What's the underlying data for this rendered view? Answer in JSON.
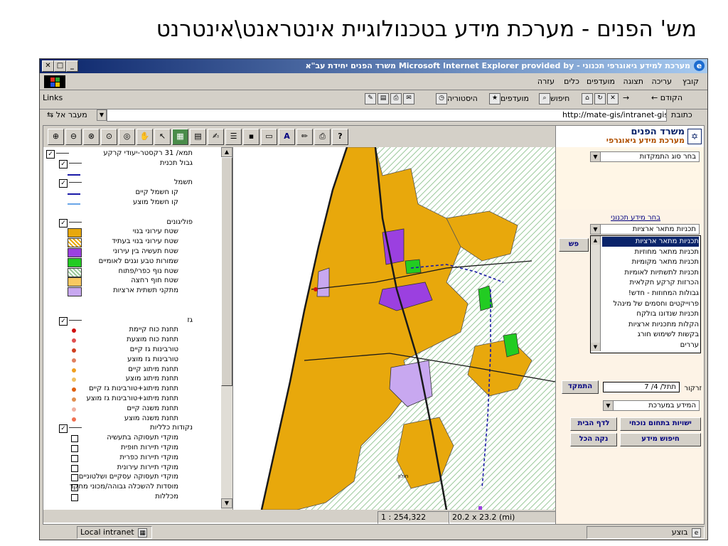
{
  "slide": {
    "title": "מש' הפנים - מערכת מידע בטכנולוגיית אינטראנט\\אינטרנט"
  },
  "window": {
    "title": "מערכת למידע גיאוגרפי תכנוני - Microsoft Internet Explorer provided by משרד הפנים יחידת עב\"א",
    "menu": [
      "קובץ",
      "עריכה",
      "תצוגה",
      "מועדפים",
      "כלים",
      "עזרה"
    ],
    "toolbar": {
      "back": "הקודם",
      "search": "חיפוש",
      "favorites": "מועדפים",
      "history": "היסטוריה",
      "links": "Links"
    },
    "address": {
      "label": "כתובת",
      "url": "http://mate-gis/intranet-gis/",
      "go": "מעבר אל"
    },
    "status": {
      "ready": "בוצע",
      "zone": "Local intranet"
    }
  },
  "legend": {
    "items": [
      {
        "label": "תמא/ 31 רקסטר-יעודי קרקע",
        "kind": "group"
      },
      {
        "label": "גבול תכנית",
        "kind": "group"
      },
      {
        "label": "",
        "kind": "line",
        "color": "#1a1aa8"
      },
      {
        "label": "תשמל",
        "kind": "group"
      },
      {
        "label": "קו חשמל קיים",
        "kind": "line",
        "color": "#1a1aa8"
      },
      {
        "label": "קו חשמל מוצע",
        "kind": "line",
        "color": "#6aa6e8"
      },
      {
        "label": "",
        "kind": "blank"
      },
      {
        "label": "פוליגונים",
        "kind": "group"
      },
      {
        "label": "שטח עירוני בנוי",
        "kind": "fill",
        "color": "#e8a80c"
      },
      {
        "label": "שטח עירוני בנוי בעתיד",
        "kind": "hatch",
        "color": "#e8a80c"
      },
      {
        "label": "שטח תעשיה בין עירוני",
        "kind": "fill",
        "color": "#9b40e0"
      },
      {
        "label": "שמורות טבע וגנים לאומיים",
        "kind": "fill",
        "color": "#22cc22"
      },
      {
        "label": "שטח נוף כפרי/פתוח",
        "kind": "hatch",
        "color": "#9ac89a"
      },
      {
        "label": "שטח חוף רחצה",
        "kind": "fill",
        "color": "#f8c860"
      },
      {
        "label": "מתקני תשתית ארציות",
        "kind": "fill",
        "color": "#c8a8f0"
      },
      {
        "label": "",
        "kind": "blank"
      },
      {
        "label": "",
        "kind": "blank"
      },
      {
        "label": "גז",
        "kind": "group"
      },
      {
        "label": "תחנת כוח קיימת",
        "kind": "dot",
        "color": "#d01010"
      },
      {
        "label": "תחנת כוח מוצעת",
        "kind": "dot",
        "color": "#e05050"
      },
      {
        "label": "טורבינות גז קיים",
        "kind": "dot",
        "color": "#d04020"
      },
      {
        "label": "טורבינות גז מוצע",
        "kind": "dot",
        "color": "#e08060"
      },
      {
        "label": "תחנת מיתוג קיים",
        "kind": "dot",
        "color": "#f0a020"
      },
      {
        "label": "תחנת מיתוג מוצע",
        "kind": "dot",
        "color": "#f0c060"
      },
      {
        "label": "תחנת מיתוג+טורבינות גז קיים",
        "kind": "dot",
        "color": "#e06010"
      },
      {
        "label": "תחנת מיתוג+טורבינות גז מוצע",
        "kind": "dot",
        "color": "#e09050"
      },
      {
        "label": "תחנת משנה קיים",
        "kind": "dot",
        "color": "#f0b0a0"
      },
      {
        "label": "תחנת משנה מוצע",
        "kind": "dot",
        "color": "#f07050"
      },
      {
        "label": "נקודות כלליות",
        "kind": "group"
      },
      {
        "label": "מוקדי תעסוקה בתעשיה",
        "kind": "sym",
        "color": "#000"
      },
      {
        "label": "מוקדי תיירות חופית",
        "kind": "sym",
        "color": "#000"
      },
      {
        "label": "מוקדי תיירות כפרית",
        "kind": "sym",
        "color": "#000"
      },
      {
        "label": "מוקדי תיירות עירונית",
        "kind": "sym",
        "color": "#000"
      },
      {
        "label": "מוקדי תעסוקה עסקיים ושלטוניים",
        "kind": "sym",
        "color": "#000"
      },
      {
        "label": "מוסדות להשכלה גבוהה/מכוני מחקר",
        "kind": "sym",
        "color": "#000"
      },
      {
        "label": "מכללות",
        "kind": "sym",
        "color": "#000"
      }
    ]
  },
  "map_status": {
    "scale": "1 : 254,322",
    "size": "20.2 x 23.2 (mi)"
  },
  "right_panel": {
    "logo_line1": "משרד הפנים",
    "logo_line2": "מערכת מידע גיאוגרפי",
    "focus_type": "בחר סוג התמקדות",
    "plan_info_link": "בחר מידע תכנוני",
    "plan_select": "תכניות מתאר ארציות",
    "list_items": [
      "תכניות מתאר ארציות",
      "תכניות מתאר מחוזיות",
      "תכניות מתאר מקומיות",
      "תכניות לתשתיות לאומיות",
      "הכרזות קרקע חקלאית",
      "גבולות המחוזות - חדש!",
      "פרוייקטים וחסמים של מינהל",
      "תכניות שנדונו בולקח",
      "הקלות מתכניות ארציות",
      "בקשות לשימוש חורג",
      "עררים"
    ],
    "zoom_label": "זרקור",
    "zoom_value": "תתל/ 4/ 7",
    "focus_btn": "התמקד",
    "info_select": "המידע במערכת",
    "btn_entities": "ישויות בתחום נוכחי",
    "btn_home": "לדף הבית",
    "btn_search": "חיפוש מידע",
    "btn_clear": "נקה הכל",
    "btn_hidden": "פש"
  },
  "map_labels": {
    "town": "חולון"
  },
  "colors": {
    "urban": "#e8a80c",
    "industry": "#9b40e0",
    "nature": "#22cc22",
    "infra": "#c8a8f0",
    "hatch": "#9ac89a",
    "title": "#0a246a"
  }
}
